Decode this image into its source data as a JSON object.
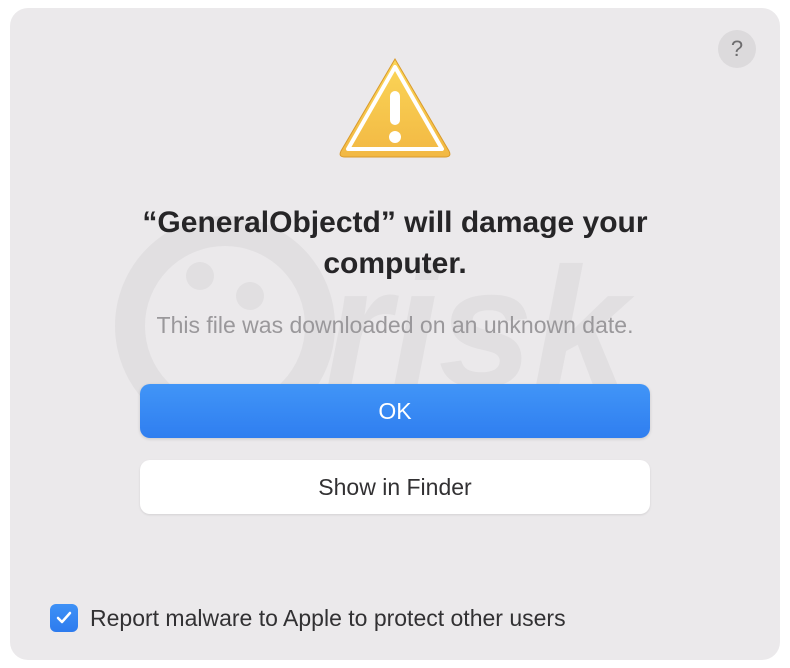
{
  "dialog": {
    "help_label": "?",
    "title": "“GeneralObjectd” will damage your computer.",
    "subtitle": "This file was downloaded on an unknown date.",
    "ok_label": "OK",
    "show_in_finder_label": "Show in Finder",
    "checkbox_label": "Report malware to Apple to protect other users",
    "checkbox_checked": true
  },
  "colors": {
    "background": "#ebe9eb",
    "primary_button": "#3e8cf4",
    "text_primary": "#262527",
    "text_secondary": "#9a989b"
  }
}
